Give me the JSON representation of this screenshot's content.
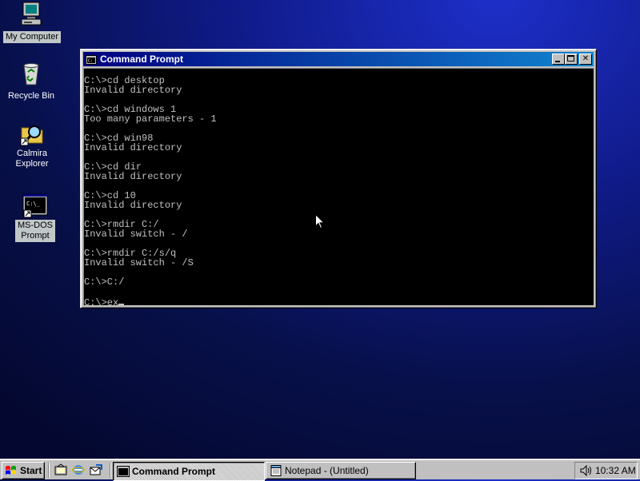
{
  "desktop": {
    "icons": [
      {
        "label": "My Computer",
        "icon": "my-computer-icon"
      },
      {
        "label": "Recycle Bin",
        "icon": "recycle-bin-icon"
      },
      {
        "label": "Calmira Explorer",
        "icon": "calmira-explorer-icon"
      },
      {
        "label": "MS-DOS Prompt",
        "icon": "ms-dos-prompt-icon"
      }
    ],
    "icon_labels_split": {
      "calmira_line1": "Calmira",
      "calmira_line2": "Explorer",
      "msdos_line1": "MS-DOS",
      "msdos_line2": "Prompt"
    }
  },
  "window": {
    "title": "Command Prompt",
    "buttons": [
      "minimize",
      "maximize",
      "close"
    ],
    "console_lines": [
      "C:\\>cd desktop",
      "Invalid directory",
      "",
      "C:\\>cd windows 1",
      "Too many parameters - 1",
      "",
      "C:\\>cd win98",
      "Invalid directory",
      "",
      "C:\\>cd dir",
      "Invalid directory",
      "",
      "C:\\>cd 10",
      "Invalid directory",
      "",
      "C:\\>rmdir C:/",
      "Invalid switch - /",
      "",
      "C:\\>rmdir C:/s/q",
      "Invalid switch - /S",
      "",
      "C:\\>C:/",
      ""
    ],
    "current_input": "C:\\>ex"
  },
  "taskbar": {
    "start_label": "Start",
    "quick_launch": [
      "show-desktop-icon",
      "internet-explorer-icon",
      "outlook-express-icon"
    ],
    "tasks": [
      {
        "label": "Command Prompt",
        "active": true,
        "icon": "command-prompt-icon"
      },
      {
        "label": "Notepad - (Untitled)",
        "active": false,
        "icon": "notepad-icon"
      }
    ],
    "tray": {
      "time": "10:32 AM",
      "icon": "volume-icon"
    }
  },
  "colors": {
    "title_gradient_start": "#000080",
    "title_gradient_end": "#1084d0",
    "console_bg": "#000000",
    "console_fg": "#c0c0c0",
    "chrome": "#c0c0c0"
  }
}
